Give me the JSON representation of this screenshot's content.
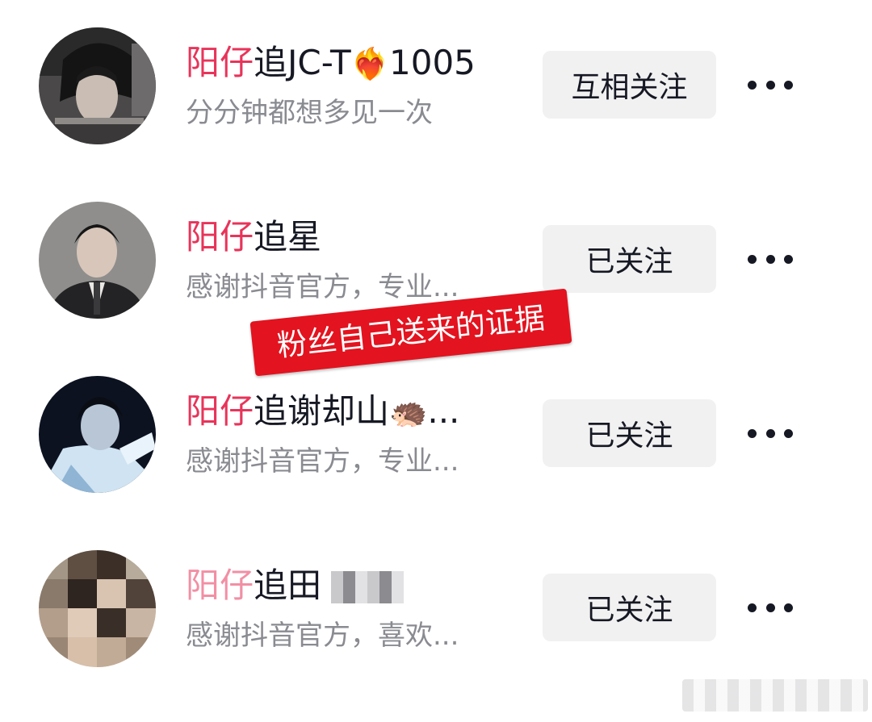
{
  "follow_list": [
    {
      "name_highlight": "阳仔",
      "name_rest": "追JC-T",
      "name_emoji": "❤️‍🔥",
      "name_suffix": "1005",
      "subtitle": "分分钟都想多见一次",
      "button": "互相关注"
    },
    {
      "name_highlight": "阳仔",
      "name_rest": "追星",
      "subtitle": "感谢抖音官方，专业...",
      "button": "已关注"
    },
    {
      "name_highlight": "阳仔",
      "name_rest": "追谢却山",
      "name_emoji": "🦔",
      "name_suffix": "...",
      "subtitle": "感谢抖音官方，专业...",
      "button": "已关注"
    },
    {
      "name_highlight": "阳仔",
      "name_rest": "追田",
      "subtitle": "感谢抖音官方，喜欢...",
      "button": "已关注"
    }
  ],
  "annotation": "粉丝自己送来的证据",
  "colors": {
    "highlight": "#e8345a",
    "stamp": "#e3131f",
    "button_bg": "#f1f1f2",
    "subtitle": "#8a8b91"
  },
  "icons": {
    "more": "more-horizontal-icon"
  }
}
